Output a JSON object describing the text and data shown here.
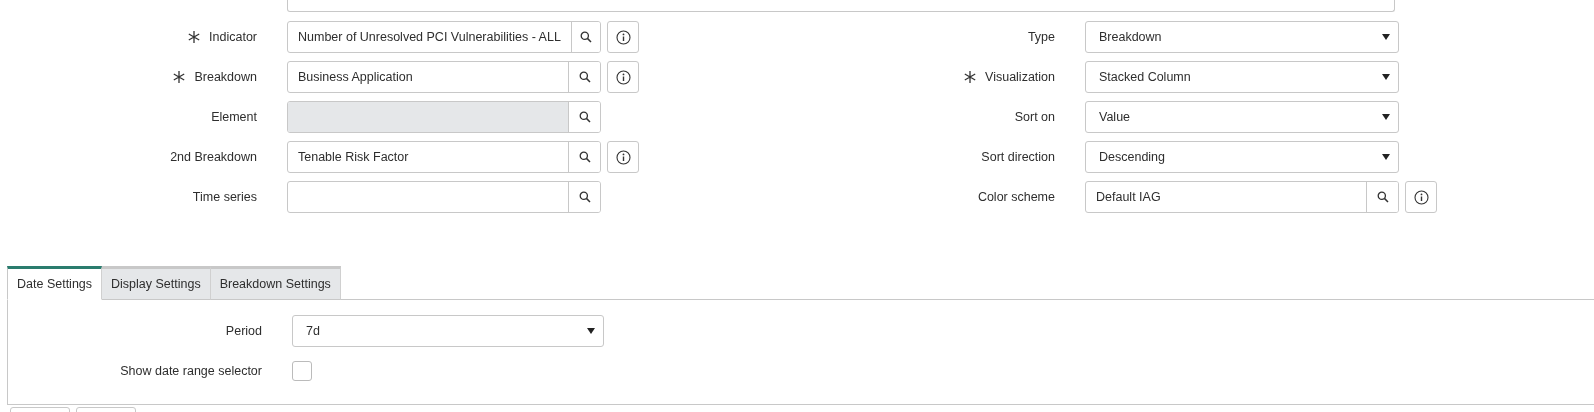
{
  "top_field": {
    "kind": "text"
  },
  "left_fields": [
    {
      "label": "Indicator",
      "required": true,
      "kind": "lookup",
      "value": "Number of Unresolved PCI Vulnerabilities - ALL",
      "info": true,
      "disabled": false
    },
    {
      "label": "Breakdown",
      "required": true,
      "kind": "lookup",
      "value": "Business Application",
      "info": true,
      "disabled": false
    },
    {
      "label": "Element",
      "required": false,
      "kind": "lookup",
      "info": false,
      "disabled": true
    },
    {
      "label": "2nd Breakdown",
      "required": false,
      "kind": "lookup",
      "value": "Tenable Risk Factor",
      "info": true,
      "disabled": false
    },
    {
      "label": "Time series",
      "required": false,
      "kind": "lookup",
      "info": false,
      "disabled": false
    }
  ],
  "right_fields": [
    {
      "label": "Type",
      "required": false,
      "kind": "select",
      "value": "Breakdown"
    },
    {
      "label": "Visualization",
      "required": true,
      "kind": "select",
      "value": "Stacked Column"
    },
    {
      "label": "Sort on",
      "required": false,
      "kind": "select",
      "value": "Value"
    },
    {
      "label": "Sort direction",
      "required": false,
      "kind": "select",
      "value": "Descending"
    },
    {
      "label": "Color scheme",
      "required": false,
      "kind": "lookup",
      "value": "Default IAG",
      "info": true,
      "disabled": false
    }
  ],
  "tabs": [
    {
      "label": "Date Settings",
      "selected": true
    },
    {
      "label": "Display Settings",
      "selected": false
    },
    {
      "label": "Breakdown Settings",
      "selected": false
    }
  ],
  "tab_fields": [
    {
      "label": "Period",
      "kind": "select",
      "value": "7d"
    },
    {
      "label": "Show date range selector",
      "kind": "checkbox",
      "checked": false
    }
  ]
}
